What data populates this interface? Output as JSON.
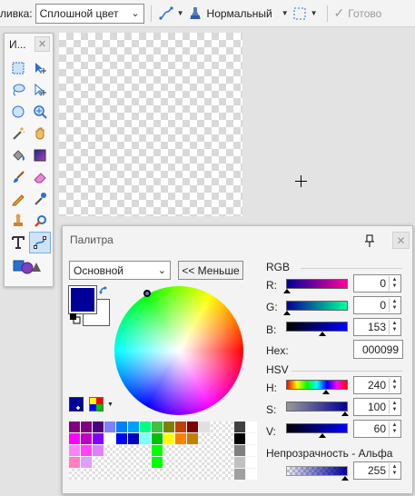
{
  "toolbar": {
    "fill_label": "ливка:",
    "fill_value": "Сплошной цвет",
    "blend_mode": "Нормальный",
    "done_label": "Готово"
  },
  "tools_window": {
    "title": "И..."
  },
  "palette_window": {
    "title": "Палитра",
    "mode_value": "Основной",
    "less_button": "<< Меньше",
    "primary_color": "#000099",
    "secondary_color": "#ffffff",
    "rgb": {
      "title": "RGB",
      "r_label": "R:",
      "r_value": "0",
      "g_label": "G:",
      "g_value": "0",
      "b_label": "B:",
      "b_value": "153"
    },
    "hex": {
      "label": "Hex:",
      "value": "000099"
    },
    "hsv": {
      "title": "HSV",
      "h_label": "H:",
      "h_value": "240",
      "s_label": "S:",
      "s_value": "100",
      "v_label": "V:",
      "v_value": "60"
    },
    "alpha": {
      "title": "Непрозрачность - Альфа",
      "value": "255"
    },
    "swatches": [
      "#800080",
      "#800080",
      "#4b0082",
      "#8080ff",
      "#0080ff",
      "#00a0ff",
      "#00ff80",
      "#40c040",
      "#808000",
      "#c04000",
      "#800000",
      "#e0e0e0",
      "empty",
      "empty",
      "#404040",
      "#ffffff",
      "#ff00ff",
      "#c000c0",
      "#8000ff",
      "#ffffff",
      "#0000ff",
      "#0000c0",
      "#80ffff",
      "#00c000",
      "#ffff00",
      "#ff8000",
      "#c08000",
      "empty",
      "empty",
      "empty",
      "#000000",
      "#ffffff",
      "#ff80ff",
      "#ff40ff",
      "#e080ff",
      "empty",
      "empty",
      "empty",
      "empty",
      "#00ff00",
      "empty",
      "empty",
      "empty",
      "empty",
      "empty",
      "empty",
      "#808080",
      "#ffffff",
      "#ff80c0",
      "#e0a0ff",
      "empty",
      "empty",
      "empty",
      "empty",
      "empty",
      "#00ff00",
      "empty",
      "empty",
      "empty",
      "empty",
      "empty",
      "empty",
      "#c0c0c0",
      "#ffffff",
      "empty",
      "empty",
      "empty",
      "empty",
      "empty",
      "empty",
      "empty",
      "empty",
      "empty",
      "empty",
      "empty",
      "empty",
      "empty",
      "empty",
      "#a0a0a0",
      "#ffffff"
    ]
  }
}
